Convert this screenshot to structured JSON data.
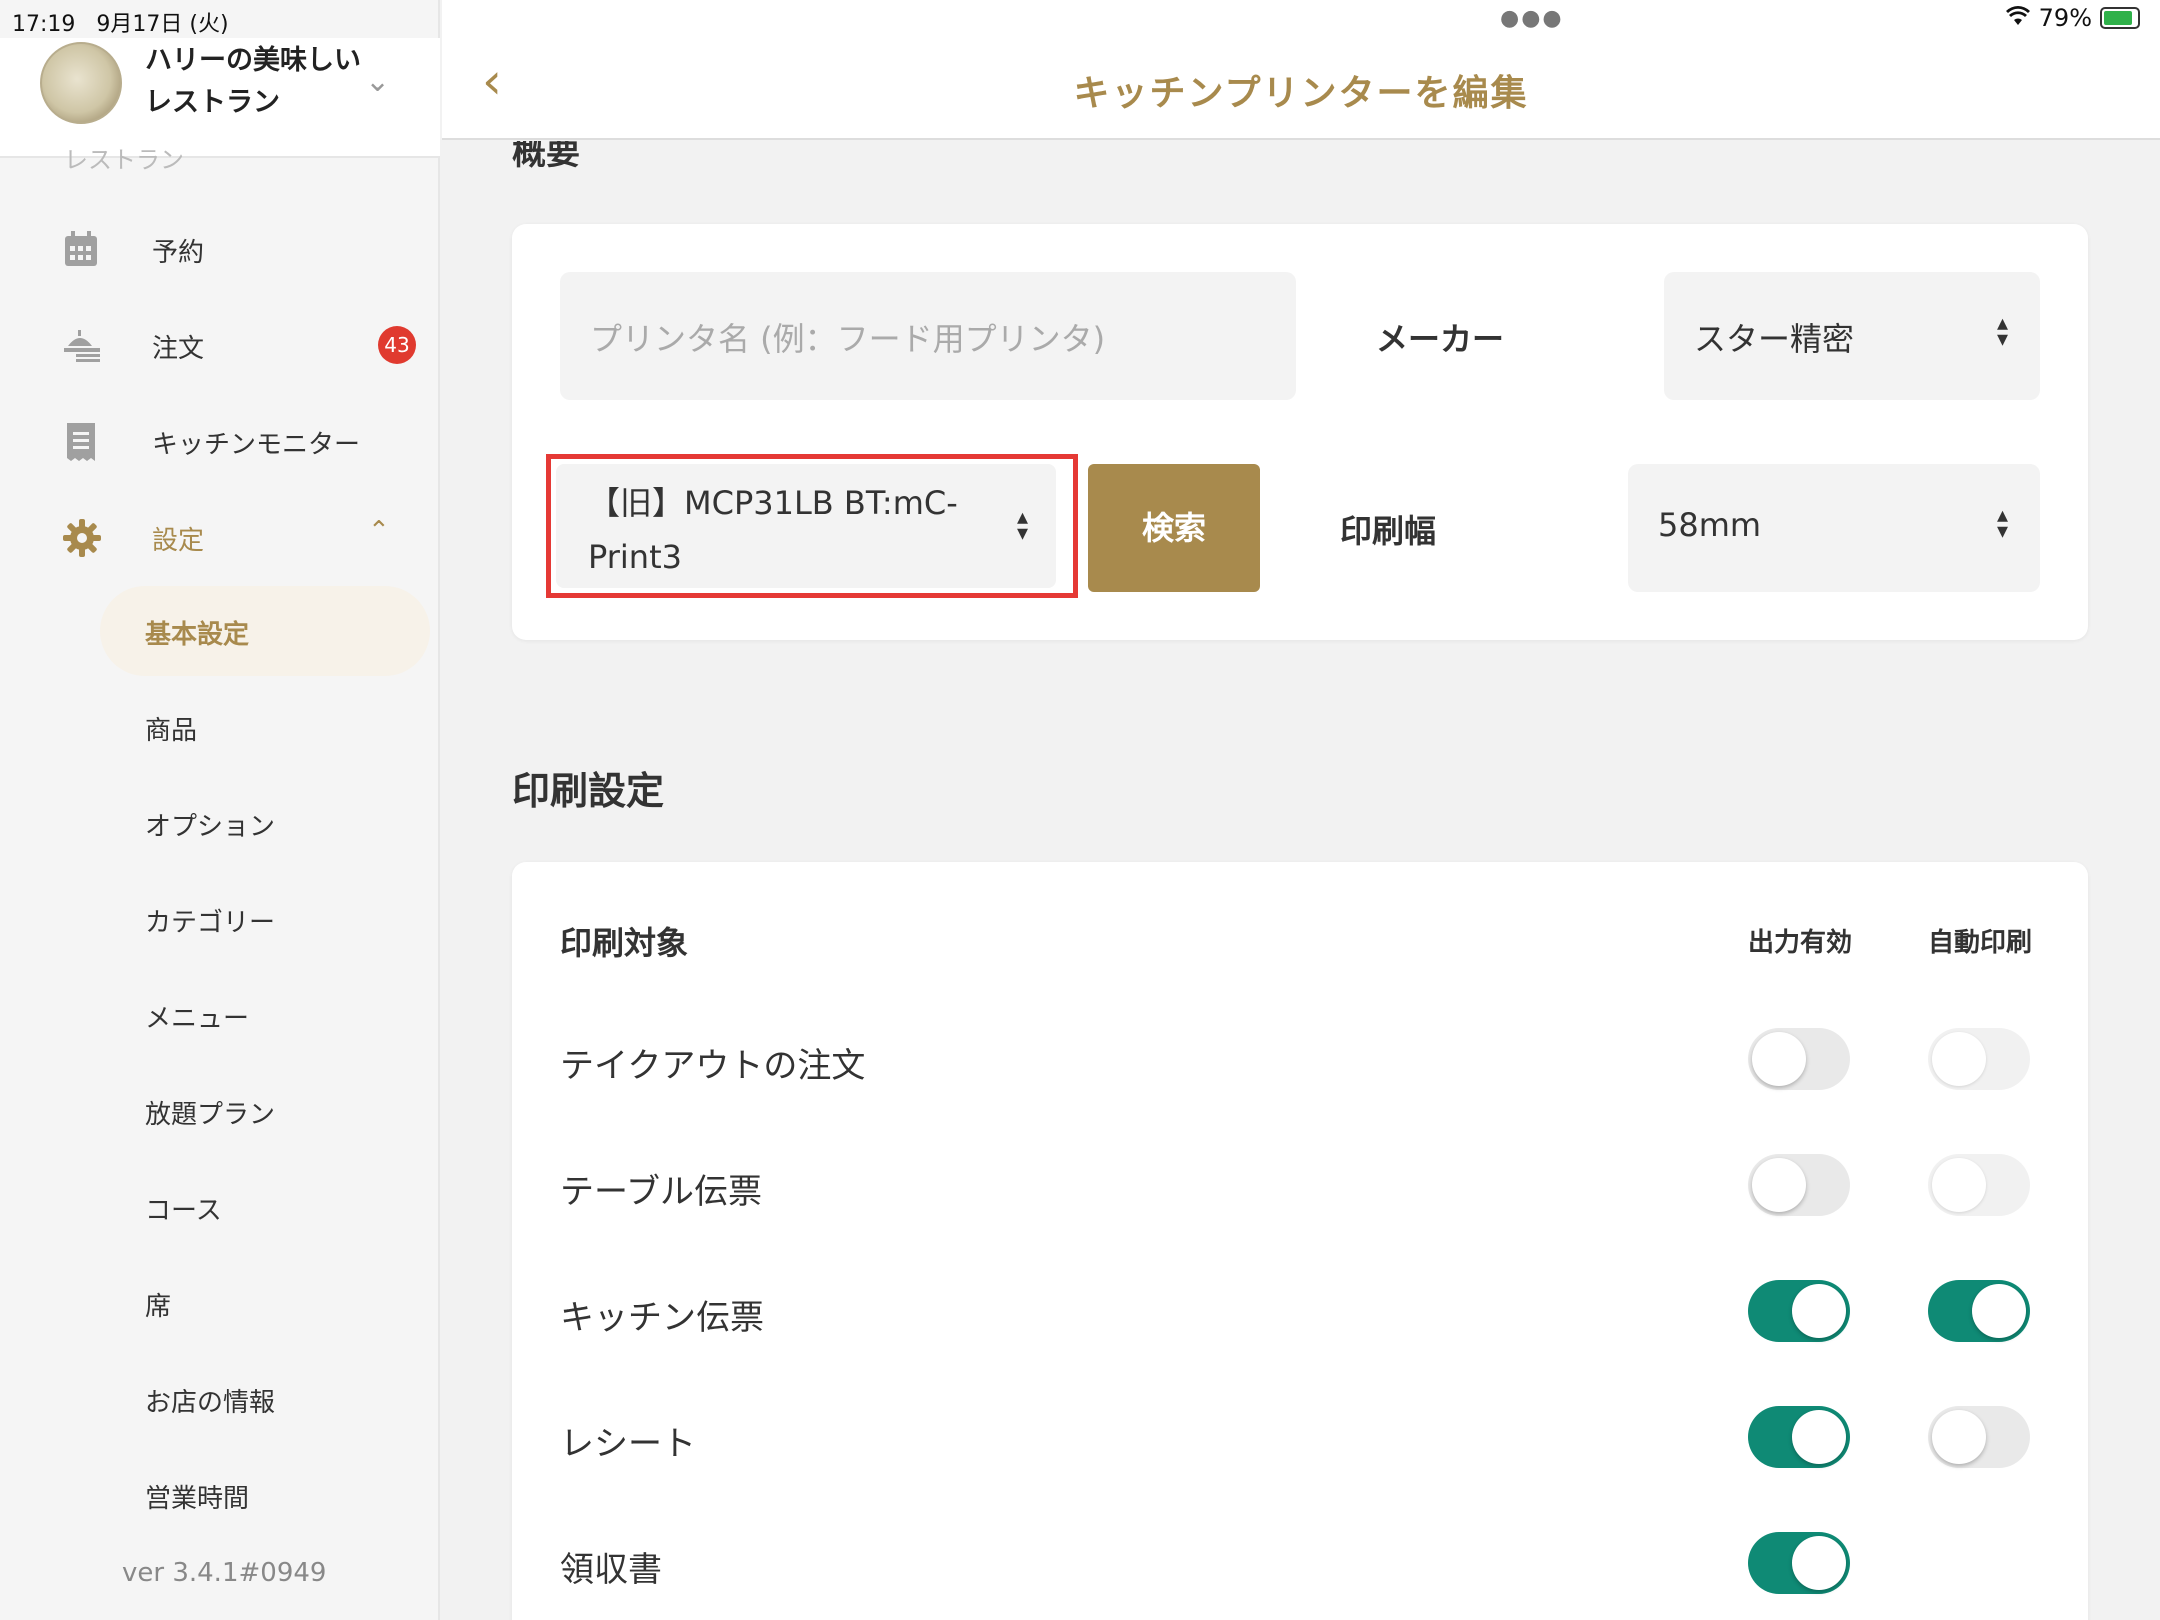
{
  "status_bar": {
    "time": "17:19",
    "date": "9月17日 (火)",
    "battery": "79%"
  },
  "restaurant": {
    "name": "ハリーの美味しいレストラン",
    "cut_label": "レストラン"
  },
  "nav": {
    "reservation": "予約",
    "orders": "注文",
    "orders_badge": "43",
    "kitchen_monitor": "キッチンモニター",
    "settings": "設定",
    "sub": [
      "基本設定",
      "商品",
      "オプション",
      "カテゴリー",
      "メニュー",
      "放題プラン",
      "コース",
      "席",
      "お店の情報",
      "営業時間"
    ]
  },
  "version": "ver 3.4.1#0949",
  "header": {
    "title": "キッチンプリンターを編集",
    "back": "‹"
  },
  "overview": {
    "section_title": "概要",
    "printer_name_placeholder": "プリンタ名 (例：フード用プリンタ)",
    "maker_label": "メーカー",
    "maker_value": "スター精密",
    "model_value": "【旧】MCP31LB BT:mC-Print3",
    "search_button": "検索",
    "width_label": "印刷幅",
    "width_value": "58mm"
  },
  "print_settings": {
    "section_title": "印刷設定",
    "col_target": "印刷対象",
    "col_output": "出力有効",
    "col_auto": "自動印刷",
    "rows": [
      {
        "label": "テイクアウトの注文",
        "output": false,
        "auto": false
      },
      {
        "label": "テーブル伝票",
        "output": false,
        "auto": false
      },
      {
        "label": "キッチン伝票",
        "output": true,
        "auto": true
      },
      {
        "label": "レシート",
        "output": true,
        "auto": false
      },
      {
        "label": "領収書",
        "output": true
      }
    ]
  }
}
